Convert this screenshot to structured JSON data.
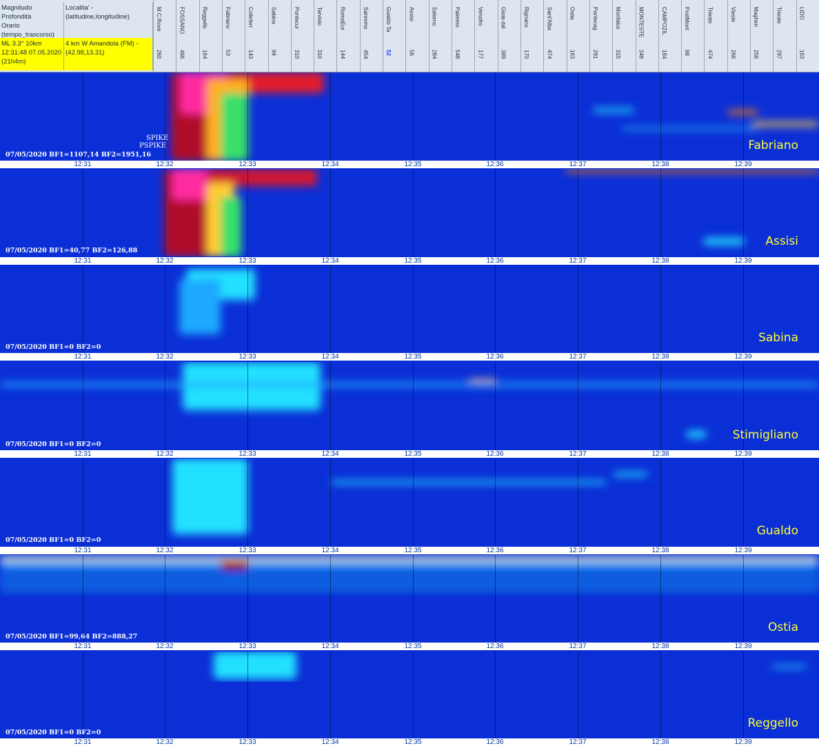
{
  "header": {
    "left_top_lines": [
      "Magnitudo Profondità",
      "Orario",
      "(tempo_trascorso)"
    ],
    "loc_top_lines": [
      "Localita' -",
      "(latitudine,longitudine)"
    ],
    "left_bot_lines": [
      "ML 3.3° 10km",
      "12:31:48 07.05.2020",
      "(21h4m)"
    ],
    "loc_bot_lines": [
      "4 km W Amandola (FM) -",
      "(42.98,13.31)"
    ],
    "stations": [
      {
        "name": "M.C.Rove",
        "dist": "260"
      },
      {
        "name": "FOSSANO",
        "dist": "466"
      },
      {
        "name": "Reggello",
        "dist": "164"
      },
      {
        "name": "Fabriano",
        "dist": "53"
      },
      {
        "name": "Colleferr",
        "dist": "143"
      },
      {
        "name": "Sabina",
        "dist": "94"
      },
      {
        "name": "Pontecur",
        "dist": "310"
      },
      {
        "name": "Tarvisio",
        "dist": "310"
      },
      {
        "name": "RomaEur",
        "dist": "144"
      },
      {
        "name": "Sanremo",
        "dist": "454"
      },
      {
        "name": "Gualdo Ta",
        "dist": "52",
        "highlight": true
      },
      {
        "name": "Assisi",
        "dist": "56"
      },
      {
        "name": "Salerno",
        "dist": "284"
      },
      {
        "name": "Palermo",
        "dist": "548"
      },
      {
        "name": "Venafro",
        "dist": "177"
      },
      {
        "name": "Gioia del",
        "dist": "389"
      },
      {
        "name": "Rignano",
        "dist": "170"
      },
      {
        "name": "Sant'Alba",
        "dist": "474"
      },
      {
        "name": "Ostia",
        "dist": "163"
      },
      {
        "name": "Pontecag",
        "dist": "291"
      },
      {
        "name": "Monfalco",
        "dist": "315"
      },
      {
        "name": "MONTESTE",
        "dist": "348"
      },
      {
        "name": "CAMPOZIL",
        "dist": "184"
      },
      {
        "name": "PostMont",
        "dist": "98"
      },
      {
        "name": "Trieste",
        "dist": "474"
      },
      {
        "name": "Vieste",
        "dist": "266"
      },
      {
        "name": "Magheri",
        "dist": "256"
      },
      {
        "name": "Trieste",
        "dist": "297"
      },
      {
        "name": "LIDO",
        "dist": "163"
      }
    ]
  },
  "time_ticks": [
    "12:31",
    "12:32",
    "12:33",
    "12:34",
    "12:35",
    "12:36",
    "12:37",
    "12:38",
    "12:39"
  ],
  "spike_labels": [
    "SPIKE",
    "PSPIKE"
  ],
  "panels": [
    {
      "station": "Fabriano",
      "bf": "07/05/2020 BF1=1107,14 BF2=1951,16"
    },
    {
      "station": "Assisi",
      "bf": "07/05/2020 BF1=40,77 BF2=126,88"
    },
    {
      "station": "Sabina",
      "bf": "07/05/2020 BF1=0 BF2=0"
    },
    {
      "station": "Stimigliano",
      "bf": "07/05/2020 BF1=0 BF2=0"
    },
    {
      "station": "Gualdo",
      "bf": "07/05/2020 BF1=0 BF2=0"
    },
    {
      "station": "Ostia",
      "bf": "07/05/2020 BF1=99,64 BF2=888,27"
    },
    {
      "station": "Reggello",
      "bf": "07/05/2020 BF1=0 BF2=0"
    }
  ],
  "colors": {
    "background": "#0b2fd6",
    "hot": "#c8102e",
    "magenta": "#ff2aa0",
    "label": "#ffff33",
    "highlight": "#ffff00"
  }
}
